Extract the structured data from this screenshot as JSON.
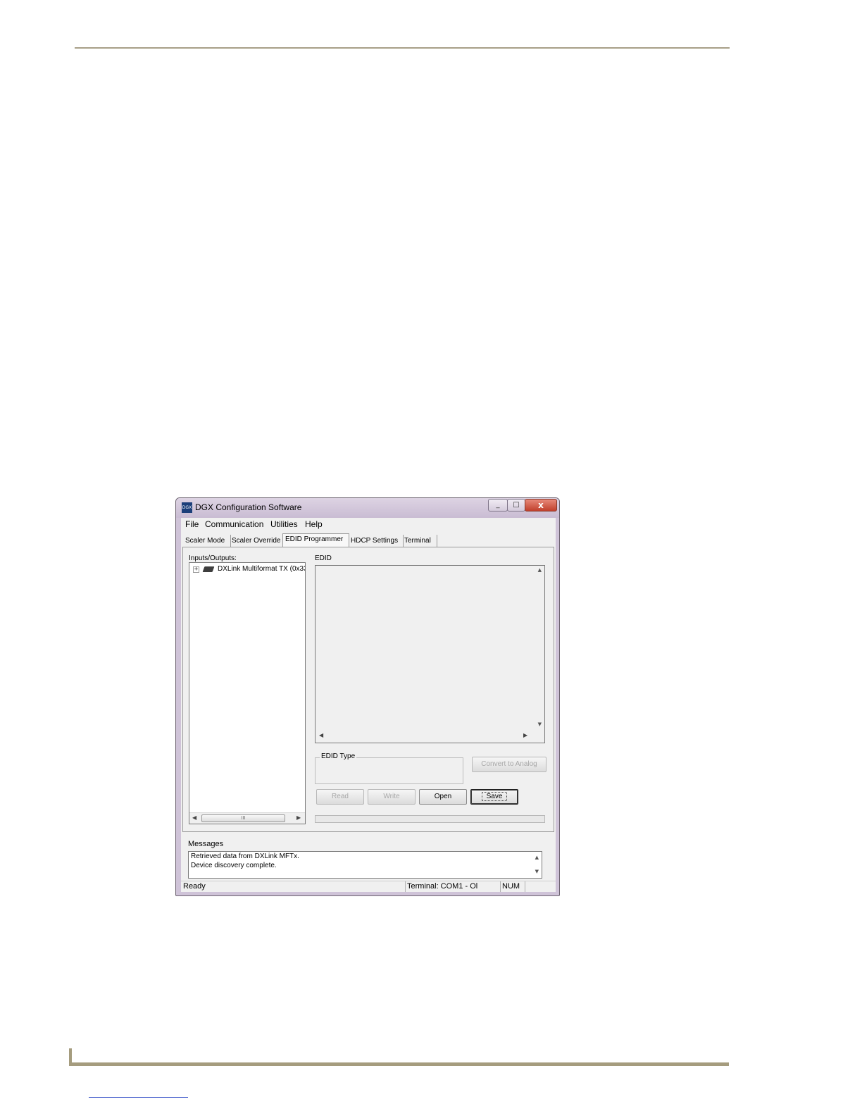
{
  "window": {
    "title": "DGX Configuration Software",
    "app_icon_text": "DGX",
    "controls": {
      "minimize": "_",
      "maximize": "□",
      "close": "x"
    }
  },
  "menu": [
    "File",
    "Communication",
    "Utilities",
    "Help"
  ],
  "tabs": [
    {
      "label": "Scaler Mode",
      "active": false
    },
    {
      "label": "Scaler Override",
      "active": false
    },
    {
      "label": "EDID Programmer",
      "active": true
    },
    {
      "label": "HDCP Settings",
      "active": false
    },
    {
      "label": "Terminal",
      "active": false
    }
  ],
  "inputs_outputs": {
    "label": "Inputs/Outputs:",
    "tree_items": [
      {
        "expander": "+",
        "label": "DXLink Multiformat TX (0x33"
      }
    ],
    "scroll_thumb": "III"
  },
  "edid": {
    "label": "EDID",
    "type_group_label": "EDID Type",
    "convert_button": "Convert to Analog"
  },
  "actions": {
    "read": "Read",
    "write": "Write",
    "open": "Open",
    "save": "Save"
  },
  "messages": {
    "label": "Messages",
    "lines": [
      "Retrieved data from DXLink MFTx.",
      "Device discovery complete."
    ]
  },
  "status": {
    "text": "Ready",
    "terminal": "Terminal: COM1 - Ol",
    "num": "NUM"
  },
  "icons": {
    "arrow_up": "▲",
    "arrow_down": "▼",
    "arrow_left": "◀",
    "arrow_right": "▶"
  }
}
